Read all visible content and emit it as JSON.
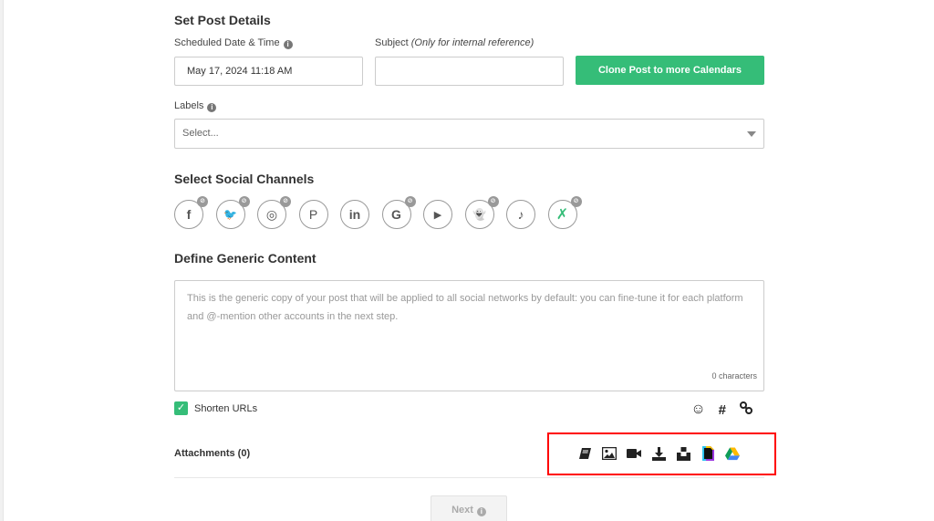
{
  "post_details": {
    "title": "Set Post Details",
    "scheduled_label": "Scheduled Date & Time",
    "scheduled_value": "May 17, 2024 11:18 AM",
    "subject_label": "Subject",
    "subject_hint": "(Only for internal reference)",
    "subject_value": "",
    "clone_button": "Clone Post to more Calendars",
    "labels_label": "Labels",
    "labels_placeholder": "Select..."
  },
  "social": {
    "title": "Select Social Channels",
    "channels": [
      {
        "name": "facebook",
        "glyph": "f",
        "disconnected": true
      },
      {
        "name": "twitter",
        "glyph": "🐦",
        "disconnected": true
      },
      {
        "name": "instagram",
        "glyph": "◎",
        "disconnected": true
      },
      {
        "name": "pinterest",
        "glyph": "P",
        "disconnected": false
      },
      {
        "name": "linkedin",
        "glyph": "in",
        "disconnected": false
      },
      {
        "name": "google-business",
        "glyph": "G",
        "disconnected": true
      },
      {
        "name": "youtube",
        "glyph": "▶",
        "disconnected": false
      },
      {
        "name": "snapchat",
        "glyph": "👻",
        "disconnected": true
      },
      {
        "name": "tiktok",
        "glyph": "♪",
        "disconnected": false
      },
      {
        "name": "custom",
        "glyph": "✗",
        "disconnected": true
      }
    ],
    "badge_glyph": "⊘"
  },
  "content": {
    "title": "Define Generic Content",
    "placeholder": "This is the generic copy of your post that will be applied to all social networks by default: you can fine-tune it for each platform and @-mention other accounts in the next step.",
    "char_count": "0 characters",
    "shorten_urls_label": "Shorten URLs",
    "shorten_urls_checked": true,
    "tools": [
      "emoji-icon",
      "hashtag-icon",
      "link-icon"
    ]
  },
  "attachments": {
    "label": "Attachments (0)",
    "icons": [
      "library-icon",
      "image-icon",
      "video-icon",
      "download-icon",
      "unsplash-icon",
      "canva-icon",
      "google-drive-icon"
    ]
  },
  "footer": {
    "next_label": "Next"
  },
  "colors": {
    "accent": "#35bd78",
    "highlight": "#ff0000"
  }
}
